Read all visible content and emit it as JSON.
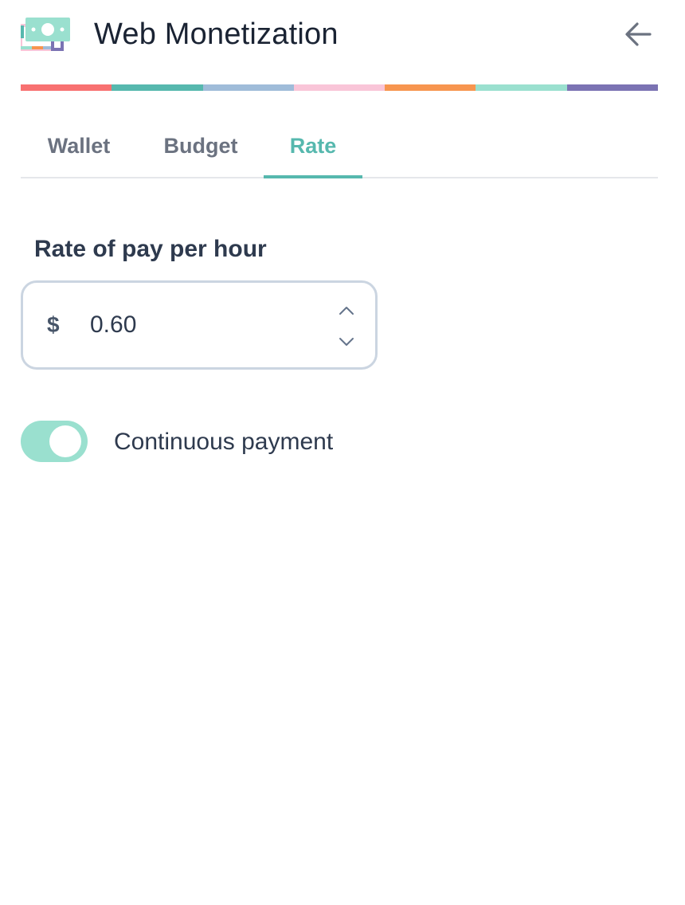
{
  "header": {
    "title": "Web Monetization",
    "logo_icon": "money-bill-icon",
    "back_icon": "arrow-left-icon"
  },
  "colors": {
    "accent": "#56b8ae",
    "stripe": [
      "#f87171",
      "#56b8ae",
      "#9fbcd9",
      "#f9c5d8",
      "#f7954f",
      "#9ae0cf",
      "#7b73b3"
    ],
    "toggle_on": "#9ae0cf"
  },
  "tabs": [
    {
      "label": "Wallet",
      "active": false
    },
    {
      "label": "Budget",
      "active": false
    },
    {
      "label": "Rate",
      "active": true
    }
  ],
  "rate": {
    "label": "Rate of pay per hour",
    "currency_symbol": "$",
    "value": "0.60",
    "increment_icon": "chevron-up-icon",
    "decrement_icon": "chevron-down-icon"
  },
  "continuous_payment": {
    "label": "Continuous payment",
    "enabled": true
  }
}
